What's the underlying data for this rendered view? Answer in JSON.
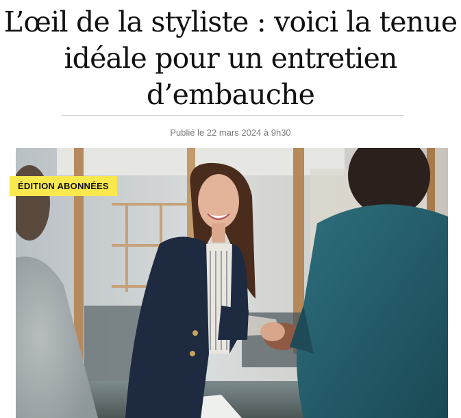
{
  "article": {
    "headline": "L’œil de la styliste : voici la tenue idéale pour un entretien d’embauche",
    "byline": "Publié le 22 mars 2024 à 9h30"
  },
  "badge": {
    "label": "Édition abonnées",
    "color": "#f9e94e"
  },
  "hero": {
    "subject": "woman-in-navy-blazer-shaking-hands-with-man-in-teal-jacket"
  }
}
